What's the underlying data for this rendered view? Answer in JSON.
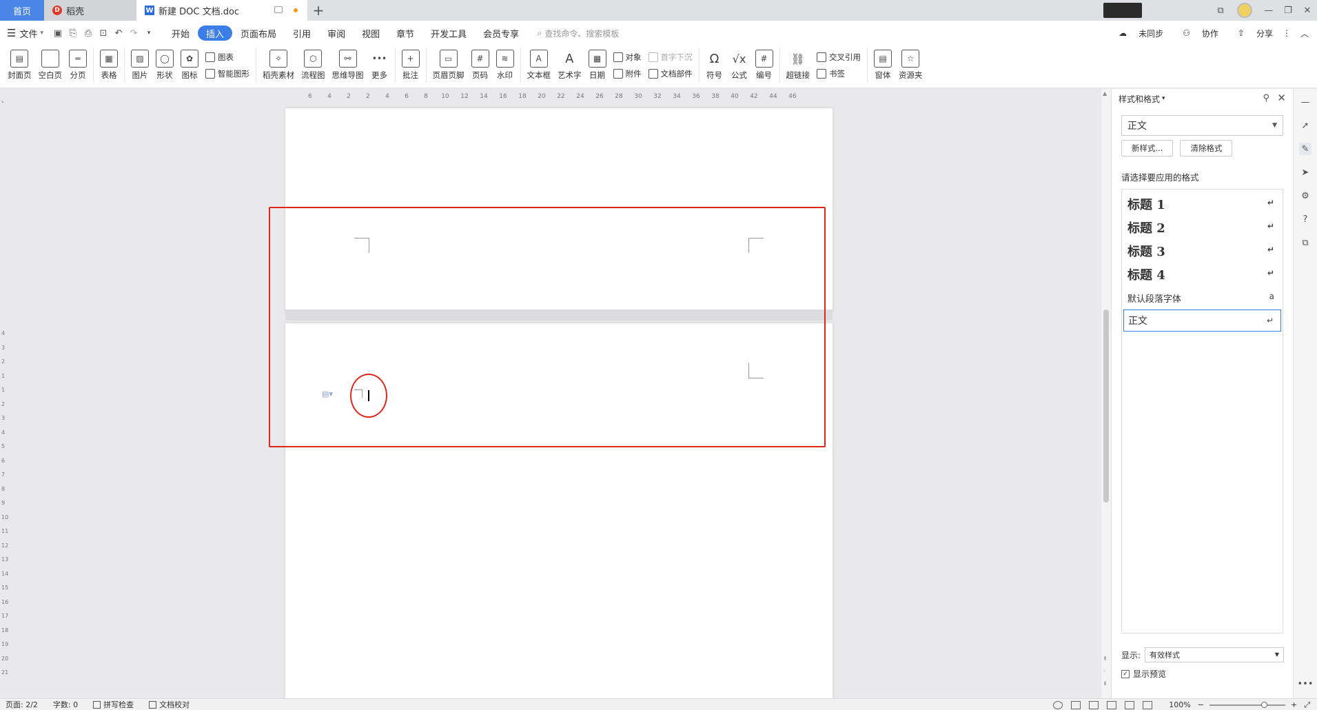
{
  "tabs": {
    "home": "首页",
    "daoke": "稻壳",
    "doc": "新建 DOC 文档.doc",
    "add": "+"
  },
  "menu": {
    "file": "文件",
    "items": [
      "开始",
      "插入",
      "页面布局",
      "引用",
      "审阅",
      "视图",
      "章节",
      "开发工具",
      "会员专享"
    ],
    "active_index": 1,
    "search_placeholder": "查找命令、搜索模板",
    "right": {
      "sync": "未同步",
      "collab": "协作",
      "share": "分享"
    }
  },
  "ribbon": {
    "cover": "封面页",
    "blank": "空白页",
    "pagebreak": "分页",
    "table": "表格",
    "picture": "图片",
    "shape": "形状",
    "icon": "图标",
    "chart": "图表",
    "smartart": "智能图形",
    "daoke_material": "稻壳素材",
    "flowchart": "流程图",
    "mindmap": "思维导图",
    "more": "更多",
    "comment": "批注",
    "header_footer": "页眉页脚",
    "page_number": "页码",
    "watermark": "水印",
    "textbox": "文本框",
    "wordart": "艺术字",
    "date": "日期",
    "object": "对象",
    "attachment": "附件",
    "dropcap": "首字下沉",
    "docparts": "文档部件",
    "symbol": "符号",
    "formula": "公式",
    "numbering": "编号",
    "hyperlink": "超链接",
    "crossref": "交叉引用",
    "bookmark": "书签",
    "form": "窗体",
    "resources": "资源夹"
  },
  "ruler": {
    "h_ticks": [
      "6",
      "4",
      "2",
      "2",
      "4",
      "6",
      "8",
      "10",
      "12",
      "14",
      "16",
      "18",
      "20",
      "22",
      "24",
      "26",
      "28",
      "30",
      "32",
      "34",
      "36",
      "38",
      "40",
      "42",
      "44",
      "46"
    ],
    "v_ticks": [
      "4",
      "3",
      "2",
      "1",
      "1",
      "2",
      "3",
      "4",
      "5",
      "6",
      "7",
      "8",
      "9",
      "10",
      "11",
      "12",
      "13",
      "14",
      "15",
      "16",
      "17",
      "18",
      "19",
      "20",
      "21"
    ]
  },
  "pane": {
    "title": "样式和格式",
    "current_style": "正文",
    "new_style": "新样式...",
    "clear_format": "清除格式",
    "select_label": "请选择要应用的格式",
    "styles": [
      {
        "name": "标题 1"
      },
      {
        "name": "标题 2"
      },
      {
        "name": "标题 3"
      },
      {
        "name": "标题 4"
      },
      {
        "name": "默认段落字体"
      },
      {
        "name": "正文"
      }
    ],
    "show_label": "显示:",
    "show_value": "有效样式",
    "preview_label": "显示预览"
  },
  "status": {
    "page": "页面: 2/2",
    "words": "字数: 0",
    "spell": "拼写检查",
    "proof": "文档校对",
    "zoom": "100%"
  }
}
